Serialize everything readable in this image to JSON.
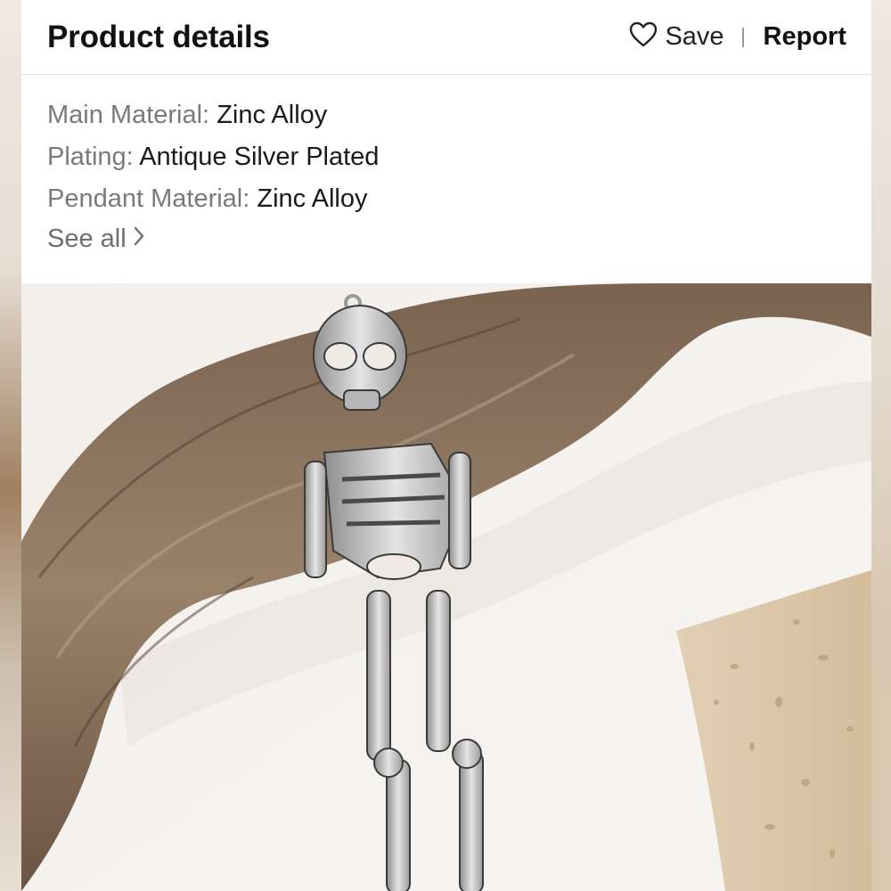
{
  "header": {
    "title": "Product details",
    "save_label": "Save",
    "report_label": "Report"
  },
  "attributes": [
    {
      "key": "Main Material:",
      "value": "Zinc Alloy"
    },
    {
      "key": "Plating:",
      "value": "Antique Silver Plated"
    },
    {
      "key": "Pendant Material:",
      "value": "Zinc Alloy"
    }
  ],
  "see_all_label": "See all",
  "icons": {
    "save": "heart-outline-icon",
    "see_all": "chevron-right-icon"
  },
  "colors": {
    "title": "#111111",
    "attribute_key": "#7a7a7a",
    "attribute_value": "#1a1a1a",
    "divider": "#e4e4e4"
  }
}
